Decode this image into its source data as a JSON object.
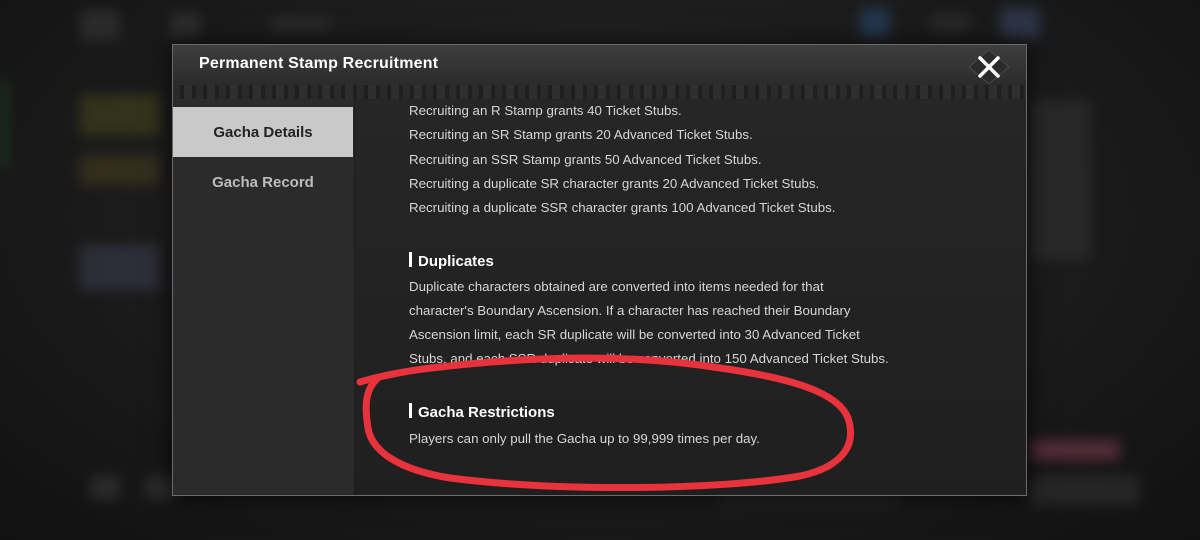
{
  "dialog": {
    "title": "Permanent Stamp Recruitment",
    "close_icon": "close-icon"
  },
  "sidebar": {
    "tabs": [
      {
        "label": "Gacha Details",
        "active": true
      },
      {
        "label": "Gacha Record",
        "active": false
      }
    ]
  },
  "content": {
    "ticket_lines": [
      "Recruiting an R Stamp grants 40 Ticket Stubs.",
      "Recruiting an SR Stamp grants 20 Advanced Ticket Stubs.",
      "Recruiting an SSR Stamp grants 50 Advanced Ticket Stubs.",
      "Recruiting a duplicate SR character grants 20 Advanced Ticket Stubs.",
      "Recruiting a duplicate SSR character grants 100 Advanced Ticket Stubs."
    ],
    "duplicates": {
      "heading": "Duplicates",
      "lines": [
        "Duplicate characters obtained are converted into items needed for that",
        "character's Boundary Ascension. If a character has reached their Boundary",
        "Ascension limit, each SR duplicate will be converted into 30 Advanced Ticket",
        "Stubs, and each SSR duplicate will be converted into 150 Advanced Ticket Stubs."
      ]
    },
    "restrictions": {
      "heading": "Gacha Restrictions",
      "text": "Players can only pull the Gacha up to 99,999 times per day."
    }
  },
  "colors": {
    "annotation": "#e8323c",
    "active_tab": "#c9c9c9"
  }
}
